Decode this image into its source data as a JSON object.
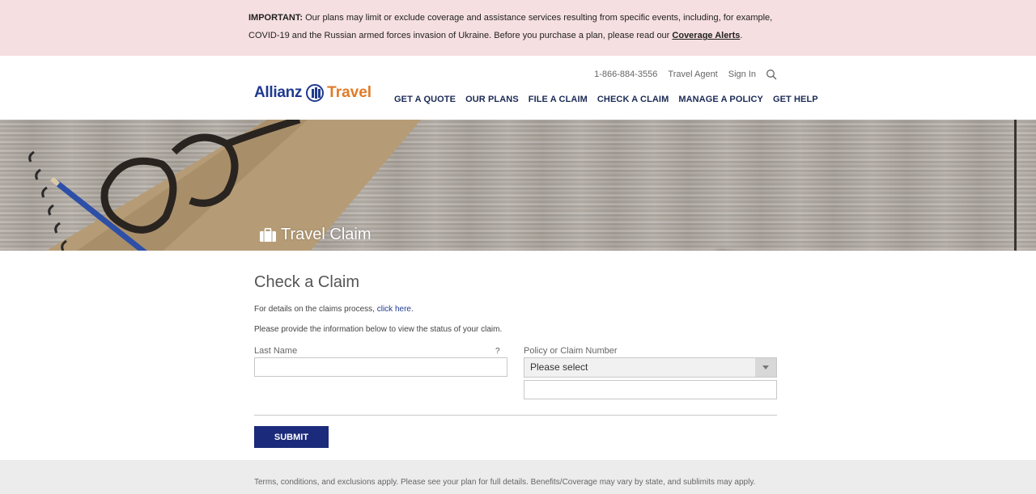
{
  "alert": {
    "strong": "IMPORTANT:",
    "text_line1": " Our plans may limit or exclude coverage and assistance services resulting from specific events, including, for example,",
    "text_line2": "COVID-19 and the Russian armed forces invasion of Ukraine. Before you purchase a plan, please read our ",
    "link": "Coverage Alerts",
    "end": "."
  },
  "header": {
    "logo_left": "Allianz",
    "logo_right": "Travel",
    "phone": "1-866-884-3556",
    "travel_agent": "Travel Agent",
    "sign_in": "Sign In",
    "nav": [
      "GET A QUOTE",
      "OUR PLANS",
      "FILE A CLAIM",
      "CHECK A CLAIM",
      "MANAGE A POLICY",
      "GET HELP"
    ]
  },
  "hero": {
    "title": "Travel Claim"
  },
  "form": {
    "title": "Check a Claim",
    "info1_prefix": "For details on the claims process, ",
    "info1_link": "click here",
    "info1_suffix": ".",
    "info2": "Please provide the information below to view the status of your claim.",
    "last_name_label": "Last Name",
    "help_mark": "?",
    "last_name_value": "",
    "policy_label": "Policy or Claim Number",
    "select_value": "Please select",
    "policy_value": "",
    "submit_label": "SUBMIT"
  },
  "footer": {
    "text": "Terms, conditions, and exclusions apply. Please see your plan for full details. Benefits/Coverage may vary by state, and sublimits may apply."
  },
  "colors": {
    "alert_bg": "#f6dfe0",
    "brand_blue": "#1f3a8f",
    "brand_orange": "#e07b28",
    "nav_text": "#1b2a55",
    "submit_bg": "#1b2a7a",
    "footer_bg": "#ececec"
  }
}
